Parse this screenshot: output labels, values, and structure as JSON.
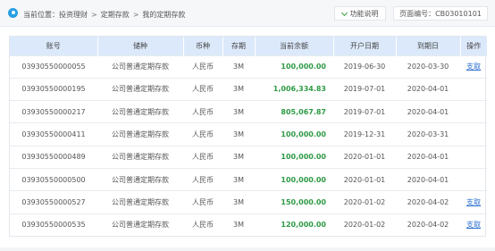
{
  "breadcrumb": {
    "prefix": "当前位置：",
    "items": [
      "投资理财",
      "定期存款",
      "我的定期存款"
    ],
    "separator": ">"
  },
  "help_button": {
    "label": "功能说明"
  },
  "page_number": {
    "label": "页面编号：CB03010101"
  },
  "table": {
    "headers": [
      "账号",
      "储种",
      "币种",
      "存期",
      "当前余额",
      "开户日期",
      "到期日",
      "操作"
    ],
    "rows": [
      {
        "account": "03930550000055",
        "type": "公司普通定期存款",
        "currency": "人民币",
        "term": "3M",
        "balance": "100,000.00",
        "open_date": "2019-06-30",
        "due_date": "2020-03-30",
        "action": "支取"
      },
      {
        "account": "03930550000195",
        "type": "公司普通定期存款",
        "currency": "人民币",
        "term": "3M",
        "balance": "1,006,334.83",
        "open_date": "2019-07-01",
        "due_date": "2020-04-01",
        "action": ""
      },
      {
        "account": "03930550000217",
        "type": "公司普通定期存款",
        "currency": "人民币",
        "term": "3M",
        "balance": "805,067.87",
        "open_date": "2019-07-01",
        "due_date": "2020-04-01",
        "action": ""
      },
      {
        "account": "03930550000411",
        "type": "公司普通定期存款",
        "currency": "人民币",
        "term": "3M",
        "balance": "100,000.00",
        "open_date": "2019-12-31",
        "due_date": "2020-03-31",
        "action": ""
      },
      {
        "account": "03930550000489",
        "type": "公司普通定期存款",
        "currency": "人民币",
        "term": "3M",
        "balance": "100,000.00",
        "open_date": "2020-01-01",
        "due_date": "2020-04-01",
        "action": ""
      },
      {
        "account": "03930550000500",
        "type": "公司普通定期存款",
        "currency": "人民币",
        "term": "3M",
        "balance": "100,000.00",
        "open_date": "2020-01-01",
        "due_date": "2020-04-01",
        "action": ""
      },
      {
        "account": "03930550000527",
        "type": "公司普通定期存款",
        "currency": "人民币",
        "term": "3M",
        "balance": "150,000.00",
        "open_date": "2020-01-02",
        "due_date": "2020-04-02",
        "action": "支取"
      },
      {
        "account": "03930550000535",
        "type": "公司普通定期存款",
        "currency": "人民币",
        "term": "3M",
        "balance": "120,000.00",
        "open_date": "2020-01-02",
        "due_date": "2020-04-02",
        "action": "支取"
      }
    ]
  },
  "colors": {
    "accent_blue": "#27a0e3",
    "header_bg": "#dbe9fb",
    "amount_green": "#2e9a45",
    "link_blue": "#2b6fd1",
    "help_check_green": "#3aa23a"
  },
  "icons": {
    "location": "location-pin-icon",
    "help": "chevron-down-icon"
  }
}
